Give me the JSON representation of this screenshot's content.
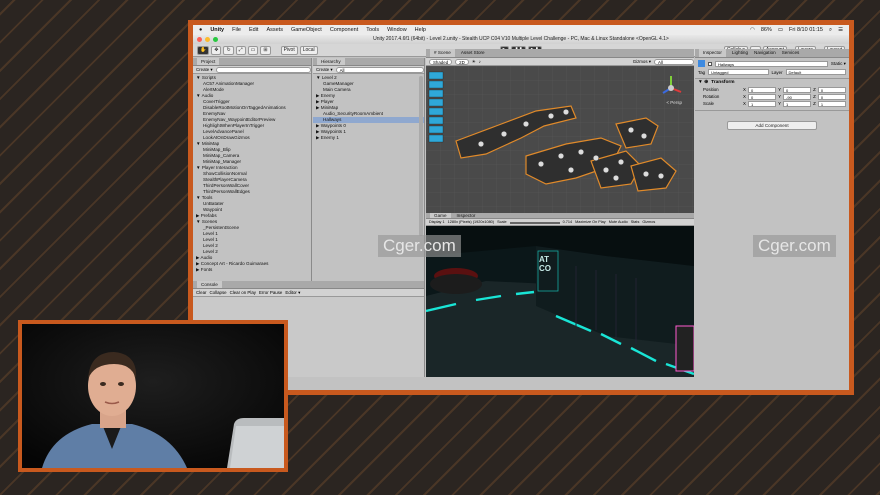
{
  "menubar": {
    "apple": "",
    "app": "Unity",
    "items": [
      "File",
      "Edit",
      "Assets",
      "GameObject",
      "Component",
      "Tools",
      "Window",
      "Help"
    ],
    "battery": "86%",
    "clock": "Fri 8/10 01:15"
  },
  "window": {
    "title": "Unity 2017.4.6f1 (64bit) - Level 2.unity - Stealth UCP C04 V10 Multiple Level Challenge - PC, Mac & Linux Standalone <OpenGL 4.1>"
  },
  "toolbar": {
    "pivot": "Pivot",
    "local": "Local",
    "play": "▶",
    "pause": "❚❚",
    "step": "▶❚",
    "collab": "Collab ▾",
    "account": "Account",
    "layers": "Layers",
    "layout": "Layout"
  },
  "project": {
    "tab": "Project",
    "create": "Create ▾",
    "items": [
      "▼ Scripts",
      "AC57 AnimationManager",
      "AlertMode",
      "▼ Audio",
      "CoverTrigger",
      "DisableRootMotionOnTaggedAnimations",
      "EnemyNav",
      "EnemyNav_WaypointEditorPreview",
      "HighlightWhenPlayerInTrigger",
      "LevelAdvancePanel",
      "LookAtOnDrawGizmos",
      "▼ MiniMap",
      "MiniMap_Blip",
      "MiniMap_Camera",
      "MiniMap_Manager",
      "▼ Player Interaction",
      "ShowCollisionNormal",
      "StealthPlayerCamera",
      "ThirdPersonWallCover",
      "ThirdPersonWallEdges",
      "▼ Tools",
      "UnBatater",
      "Waypoint",
      "▶ Prefabs",
      "▼ Scenes",
      "_PersistentScene",
      "Level 1",
      "Level 1",
      "Level 2",
      "Level 2",
      "▶ Audio",
      "▶ Concept Art - Ricardo Guimaraes",
      "▶ Fonts"
    ],
    "selected": -1
  },
  "hierarchy": {
    "tab": "Hierarchy",
    "create": "Create ▾",
    "search": "All",
    "items": [
      "▼ Level 2",
      "GameManager",
      "Main Camera",
      "▶ Enemy",
      "▶ Player",
      "▶ MiniMap",
      "Audio_SecurityRoomAmbient",
      "Hallways",
      "▶ Waypoints 0",
      "▶ Waypoints 1",
      "▶ Enemy 1"
    ],
    "selected": 7
  },
  "scene": {
    "tabs": [
      "# Scene",
      "Asset Store"
    ],
    "shading": "Shaded",
    "mode2d": "2D",
    "gizmos": "Gizmos ▾",
    "search": "All",
    "persp": "< Persp"
  },
  "game": {
    "tabs": [
      "Game",
      "Inspector"
    ],
    "display": "Display 1",
    "resolution": "1280x (Pixels) (1920x1080)",
    "scale_label": "Scale",
    "scale_value": "0.714",
    "buttons": [
      "Maximize On Play",
      "Mute Audio",
      "Stats",
      "Gizmos"
    ],
    "sign_text_1": "AT",
    "sign_text_2": "CO"
  },
  "console": {
    "tab": "Console",
    "buttons": [
      "Clear",
      "Collapse",
      "Clear on Play",
      "Error Pause",
      "Editor ▾"
    ]
  },
  "inspector": {
    "tabs": [
      "Inspector",
      "Lighting",
      "Navigation",
      "Services"
    ],
    "object_name": "Hallways",
    "static": "Static ▾",
    "tag_label": "Tag",
    "tag_value": "Untagged",
    "layer_label": "Layer",
    "layer_value": "Default",
    "component": "Transform",
    "rows": [
      {
        "label": "Position",
        "x": "0",
        "y": "0",
        "z": "0"
      },
      {
        "label": "Rotation",
        "x": "0",
        "y": "-90",
        "z": "0"
      },
      {
        "label": "Scale",
        "x": "1",
        "y": "1",
        "z": "1"
      }
    ],
    "add_component": "Add Component"
  },
  "watermarks": [
    "Cger.com",
    "Cger.com"
  ],
  "colors": {
    "frame": "#c8591e",
    "selection": "#8fa8cf",
    "neon": "#19e5d6"
  }
}
